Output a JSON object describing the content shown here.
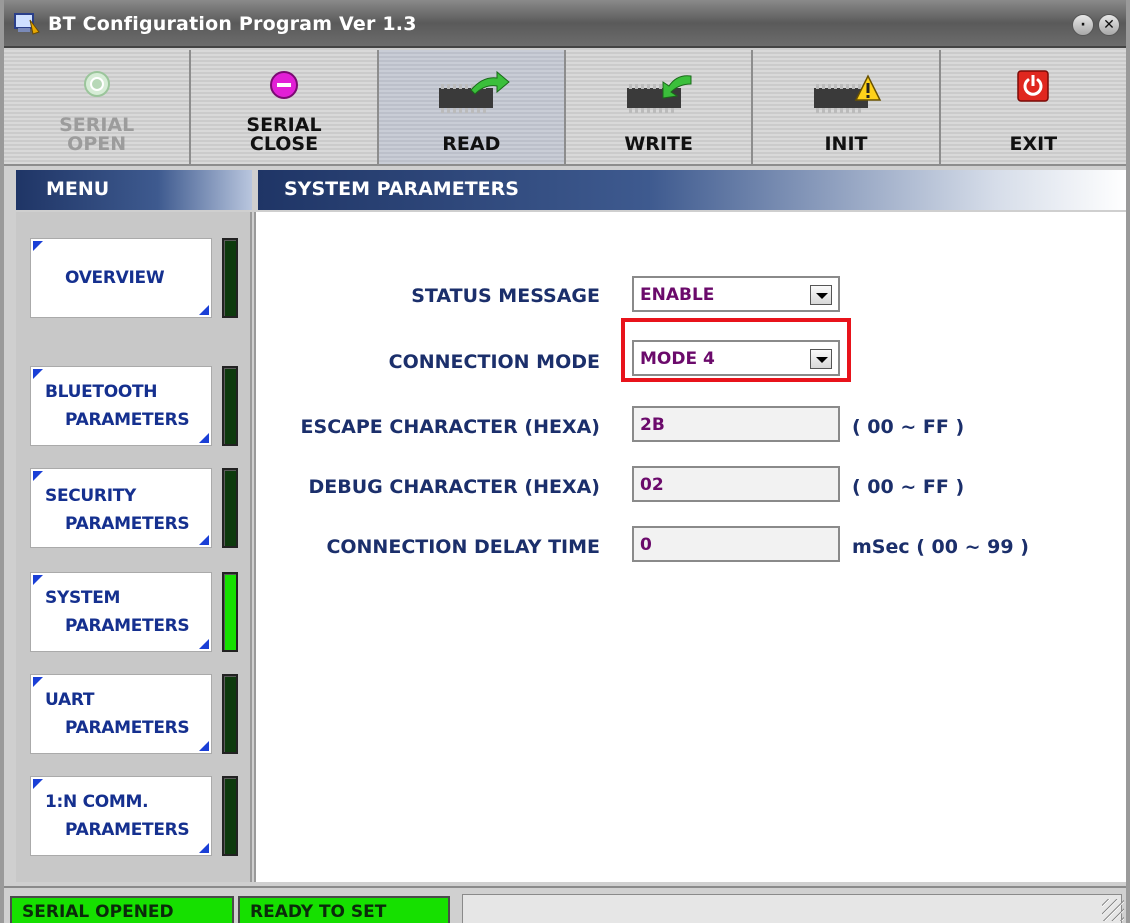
{
  "window": {
    "title": "BT Configuration Program Ver 1.3"
  },
  "toolbar": {
    "serial_open": {
      "line1": "SERIAL",
      "line2": "OPEN"
    },
    "serial_close": {
      "line1": "SERIAL",
      "line2": "CLOSE"
    },
    "read": "READ",
    "write": "WRITE",
    "init": "INIT",
    "exit": "EXIT"
  },
  "menu": {
    "header": "MENU",
    "items": [
      {
        "line1": "OVERVIEW",
        "line2": "",
        "active": false
      },
      {
        "line1": "BLUETOOTH",
        "line2": "PARAMETERS",
        "active": false
      },
      {
        "line1": "SECURITY",
        "line2": "PARAMETERS",
        "active": false
      },
      {
        "line1": "SYSTEM",
        "line2": "PARAMETERS",
        "active": true
      },
      {
        "line1": "UART",
        "line2": "PARAMETERS",
        "active": false
      },
      {
        "line1": "1:N COMM.",
        "line2": "PARAMETERS",
        "active": false
      }
    ]
  },
  "main": {
    "header": "SYSTEM PARAMETERS",
    "fields": {
      "status_message": {
        "label": "STATUS MESSAGE",
        "value": "ENABLE"
      },
      "connection_mode": {
        "label": "CONNECTION MODE",
        "value": "MODE 4"
      },
      "escape_character": {
        "label": "ESCAPE CHARACTER (HEXA)",
        "value": "2B",
        "unit": "( 00 ~ FF )"
      },
      "debug_character": {
        "label": "DEBUG CHARACTER (HEXA)",
        "value": "02",
        "unit": "( 00 ~ FF )"
      },
      "connection_delay": {
        "label": "CONNECTION DELAY TIME",
        "value": "0",
        "unit": "mSec ( 00 ~ 99 )"
      }
    }
  },
  "status": {
    "serial": "SERIAL OPENED",
    "ready": "READY TO SET"
  },
  "colors": {
    "indicator_on": "#16e000",
    "indicator_off": "#0d3a0d",
    "header_blue": "#1f3566",
    "highlight_red": "#e8131b",
    "value_purple": "#6b0a6b"
  }
}
